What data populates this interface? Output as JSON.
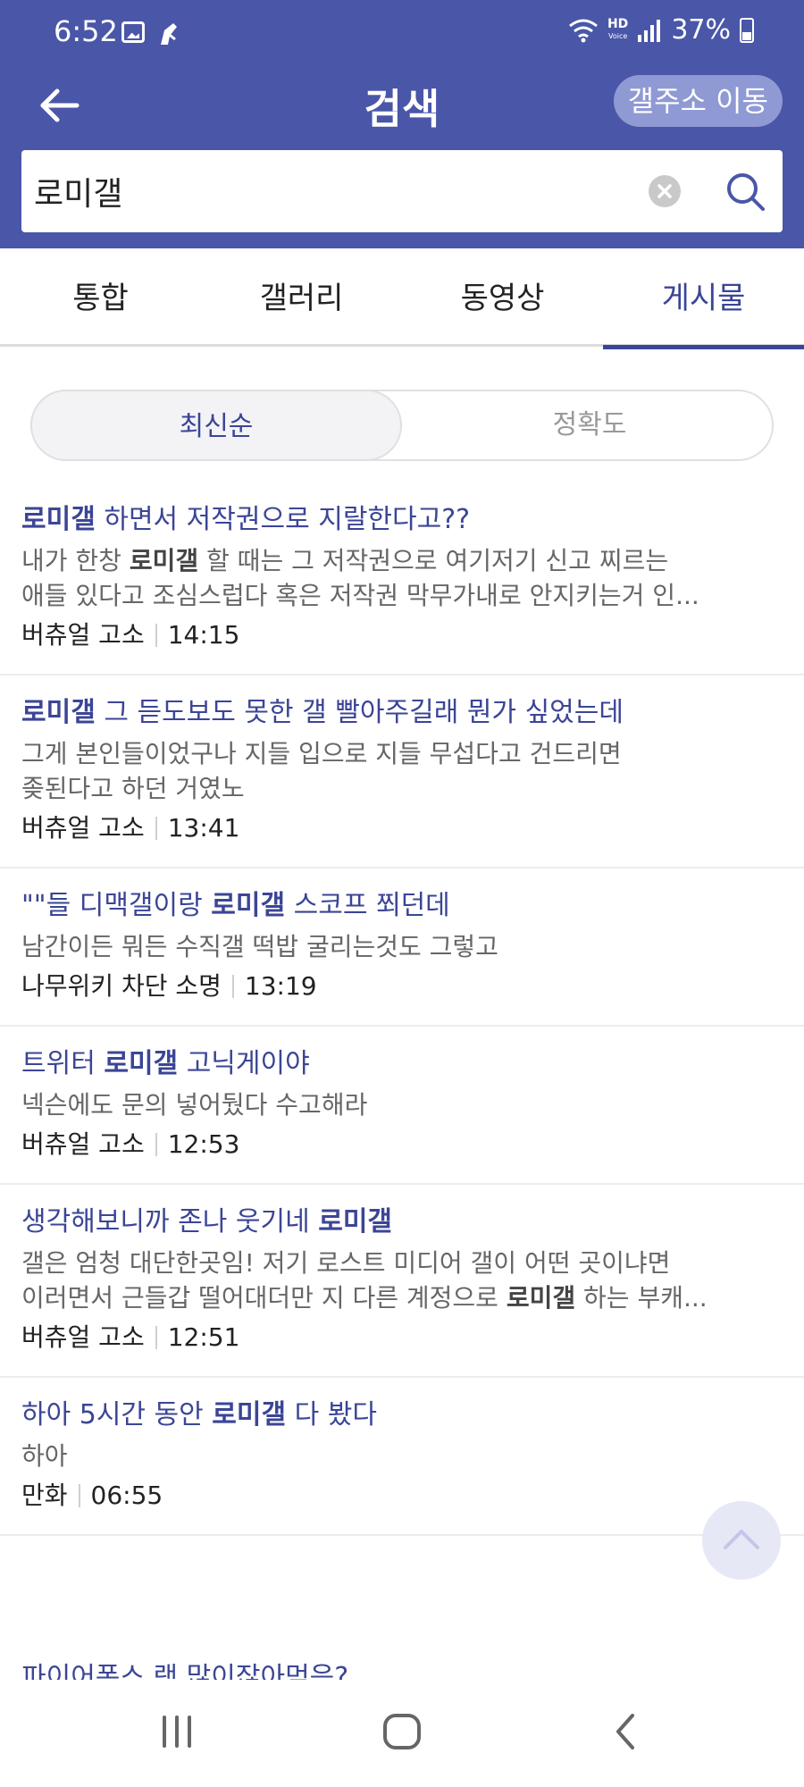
{
  "status_bar": {
    "time": "6:52",
    "hd_label": "HD",
    "voice_label": "Voice",
    "battery": "37%"
  },
  "header": {
    "title": "검색",
    "gallery_move_label": "갤주소 이동"
  },
  "search": {
    "value": "로미갤"
  },
  "tabs": [
    {
      "label": "통합",
      "active": false
    },
    {
      "label": "갤러리",
      "active": false
    },
    {
      "label": "동영상",
      "active": false
    },
    {
      "label": "게시물",
      "active": true
    }
  ],
  "sort": {
    "options": [
      "최신순",
      "정확도"
    ],
    "selected": "최신순"
  },
  "results": [
    {
      "title": [
        {
          "t": "로미갤",
          "b": true
        },
        {
          "t": " 하면서 저작권으로 지랄한다고??",
          "b": false
        }
      ],
      "body_lines": [
        [
          {
            "t": "내가 한창 ",
            "b": false
          },
          {
            "t": "로미갤",
            "b": true
          },
          {
            "t": " 할 때는 그 저작권으로 여기저기 신고 찌르는",
            "b": false
          }
        ],
        [
          {
            "t": "애들 있다고 조심스럽다 혹은 저작권 막무가내로 안지키는거 인...",
            "b": false
          }
        ]
      ],
      "gallery": "버츄얼 고소",
      "time": "14:15"
    },
    {
      "title": [
        {
          "t": "로미갤",
          "b": true
        },
        {
          "t": " 그 듣도보도 못한 갤 빨아주길래 뭔가 싶었는데",
          "b": false
        }
      ],
      "body_lines": [
        [
          {
            "t": "그게 본인들이었구나 지들 입으로 지들 무섭다고 건드리면",
            "b": false
          }
        ],
        [
          {
            "t": "좆된다고 하던 거였노",
            "b": false
          }
        ]
      ],
      "gallery": "버츄얼 고소",
      "time": "13:41"
    },
    {
      "title": [
        {
          "t": "\"\"들 디맥갤이랑 ",
          "b": false
        },
        {
          "t": "로미갤",
          "b": true
        },
        {
          "t": " 스코프 쬐던데",
          "b": false
        }
      ],
      "body_lines": [
        [
          {
            "t": "남간이든 뭐든 수직갤 떡밥 굴리는것도 그렇고",
            "b": false
          }
        ]
      ],
      "gallery": "나무위키 차단 소명",
      "time": "13:19"
    },
    {
      "title": [
        {
          "t": "트위터 ",
          "b": false
        },
        {
          "t": "로미갤",
          "b": true
        },
        {
          "t": " 고닉게이야",
          "b": false
        }
      ],
      "body_lines": [
        [
          {
            "t": "넥슨에도 문의 넣어뒀다 수고해라",
            "b": false
          }
        ]
      ],
      "gallery": "버츄얼 고소",
      "time": "12:53"
    },
    {
      "title": [
        {
          "t": "생각해보니까 존나 웃기네 ",
          "b": false
        },
        {
          "t": "로미갤",
          "b": true
        }
      ],
      "body_lines": [
        [
          {
            "t": "갤은 엄청 대단한곳임! 저기 로스트 미디어 갤이 어떤 곳이냐면",
            "b": false
          }
        ],
        [
          {
            "t": "이러면서 근들갑 떨어대더만 지 다른 계정으로 ",
            "b": false
          },
          {
            "t": "로미갤",
            "b": true
          },
          {
            "t": " 하는 부캐...",
            "b": false
          }
        ]
      ],
      "gallery": "버츄얼 고소",
      "time": "12:51"
    },
    {
      "title": [
        {
          "t": "하아 5시간 동안 ",
          "b": false
        },
        {
          "t": "로미갤",
          "b": true
        },
        {
          "t": " 다 봤다",
          "b": false
        }
      ],
      "body_lines": [
        [
          {
            "t": "하아",
            "b": false
          }
        ]
      ],
      "gallery": "만화",
      "time": "06:55"
    }
  ],
  "partial_item_title": "파이어폭스 랙 많이잖아먹음?",
  "icons": {
    "back": "arrow-left-icon",
    "clear": "clear-x-icon",
    "search": "search-icon",
    "scroll_top": "chevron-up-icon",
    "recents": "recent-apps-icon",
    "home": "home-icon",
    "nav_back": "nav-back-icon"
  },
  "colors": {
    "header_bg": "#4a56a8",
    "accent": "#3b4596",
    "gallery_btn_bg": "#8f99d3"
  }
}
